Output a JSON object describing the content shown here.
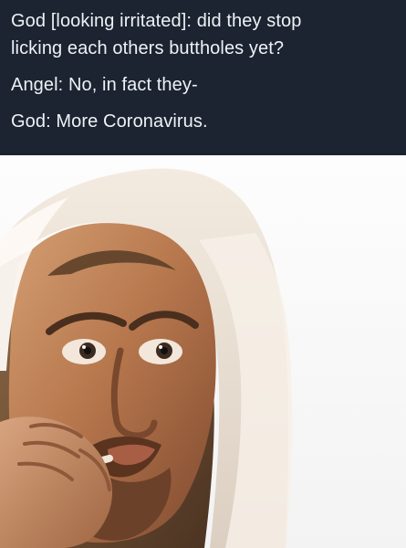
{
  "caption": {
    "lines": [
      "God [looking irritated]: did they stop",
      "licking each others buttholes yet?",
      "Angel: No, in fact they-",
      "God: More Coronavirus."
    ]
  },
  "colors": {
    "caption_background": "#1b2430",
    "caption_text": "#eef2f6",
    "photo_background": "#f7f7f7"
  },
  "image": {
    "subject_icon": "smoking-man-portrait"
  }
}
